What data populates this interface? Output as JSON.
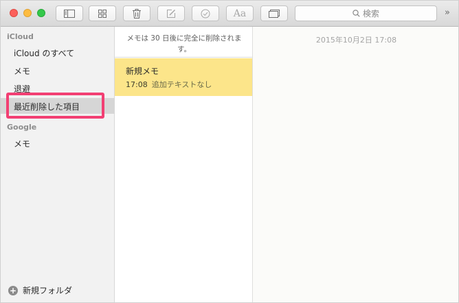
{
  "toolbar": {
    "search_placeholder": "検索",
    "font_button_label": "Aa",
    "overflow": "»"
  },
  "sidebar": {
    "sections": [
      {
        "header": "iCloud",
        "items": [
          "iCloud のすべて",
          "メモ",
          "退避",
          "最近削除した項目"
        ]
      },
      {
        "header": "Google",
        "items": [
          "メモ"
        ]
      }
    ],
    "selected_item": "最近削除した項目",
    "new_folder_label": "新規フォルダ"
  },
  "list": {
    "notice": "メモは 30 日後に完全に削除されます。",
    "notes": [
      {
        "title": "新規メモ",
        "time": "17:08",
        "preview": "追加テキストなし"
      }
    ]
  },
  "editor": {
    "date": "2015年10月2日 17:08"
  },
  "colors": {
    "selected_note_bg": "#fce58a",
    "highlight_box": "#f23f73",
    "close": "#fc605b",
    "minimize": "#fdbc40",
    "maximize": "#34c84a"
  }
}
